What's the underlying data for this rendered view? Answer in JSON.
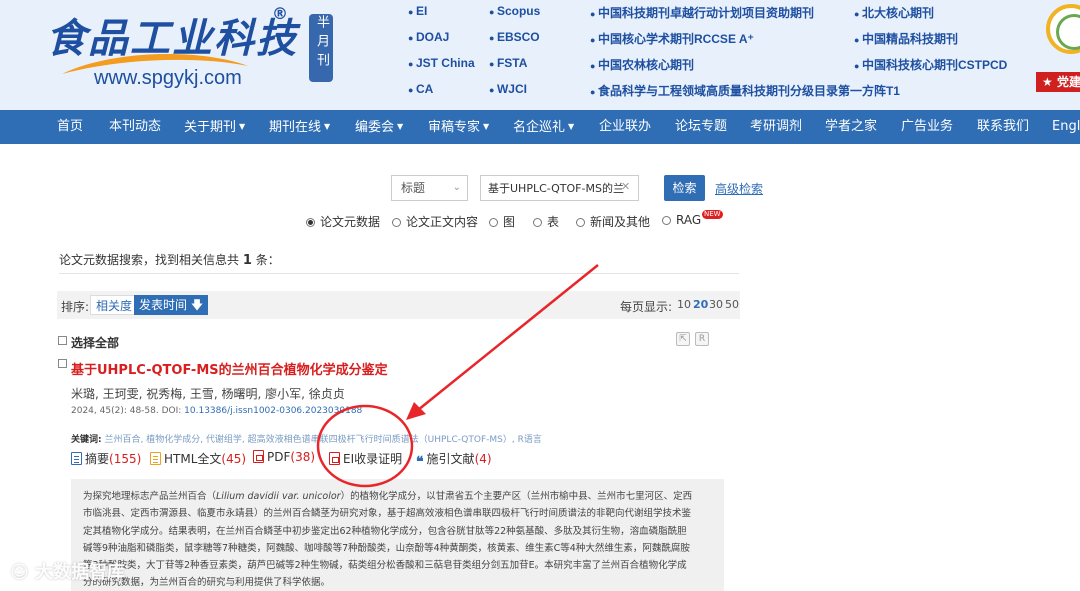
{
  "header": {
    "logo_title": "食品工业科技",
    "logo_reg": "®",
    "logo_url": "www.spgykj.com",
    "frequency": "半月刊",
    "indexes_col1": [
      "EI",
      "DOAJ",
      "JST China",
      "CA"
    ],
    "indexes_col2": [
      "Scopus",
      "EBSCO",
      "FSTA",
      "WJCI"
    ],
    "indexes_col3": [
      "中国科技期刊卓越行动计划项目资助期刊",
      "中国核心学术期刊RCCSE A⁺",
      "中国农林核心期刊",
      "食品科学与工程领域高质量科技期刊分级目录第一方阵T1"
    ],
    "indexes_col4": [
      "北大核心期刊",
      "中国精品科技期刊",
      "中国科技核心期刊CSTPCD"
    ],
    "party_tag": "党建"
  },
  "nav": {
    "items": [
      {
        "label": "首页",
        "dropdown": false
      },
      {
        "label": "本刊动态",
        "dropdown": false
      },
      {
        "label": "关于期刊",
        "dropdown": true
      },
      {
        "label": "期刊在线",
        "dropdown": true
      },
      {
        "label": "编委会",
        "dropdown": true
      },
      {
        "label": "审稿专家",
        "dropdown": true
      },
      {
        "label": "名企巡礼",
        "dropdown": true
      },
      {
        "label": "企业联办",
        "dropdown": false
      },
      {
        "label": "论坛专题",
        "dropdown": false
      },
      {
        "label": "考研调剂",
        "dropdown": false
      },
      {
        "label": "学者之家",
        "dropdown": false
      },
      {
        "label": "广告业务",
        "dropdown": false
      },
      {
        "label": "联系我们",
        "dropdown": false
      },
      {
        "label": "English",
        "dropdown": false
      }
    ]
  },
  "search": {
    "field_select": "标题",
    "query": "基于UHPLC-QTOF-MS的兰",
    "button": "检索",
    "advanced": "高级检索",
    "scopes": [
      {
        "label": "论文元数据",
        "checked": true
      },
      {
        "label": "论文正文内容",
        "checked": false
      },
      {
        "label": "图",
        "checked": false
      },
      {
        "label": "表",
        "checked": false
      },
      {
        "label": "新闻及其他",
        "checked": false
      },
      {
        "label": "RAG",
        "checked": false
      }
    ],
    "new_badge": "NEW"
  },
  "results": {
    "summary_prefix": "论文元数据搜索，找到相关信息共",
    "count": "1",
    "summary_suffix": "条：",
    "sort_label": "排序:",
    "sort_relevance": "相关度",
    "sort_time": "发表时间",
    "per_page_label": "每页显示:",
    "per_page_options": [
      "10",
      "20",
      "30",
      "50"
    ],
    "per_page_selected": "20",
    "select_all": "选择全部"
  },
  "paper": {
    "title": "基于UHPLC-QTOF-MS的兰州百合植物化学成分鉴定",
    "authors": "米璐, 王珂雯, 祝秀梅, 王雪, 杨曙明, 廖小军, 徐贞贞",
    "citation": "2024, 45(2): 48-58. DOI:",
    "doi": "10.13386/j.issn1002-0306.2023030188",
    "keywords_label": "关键词:",
    "keywords": "兰州百合, 植物化学成分, 代谢组学, 超高效液相色谱串联四极杆飞行时间质谱法（UHPLC-QTOF-MS）, R语言",
    "links": {
      "abstract": "摘要",
      "abstract_count": "(155)",
      "html": "HTML全文",
      "html_count": "(45)",
      "pdf": "PDF",
      "pdf_count": "(38)",
      "ei_cert": "EI收录证明",
      "cited": "施引文献",
      "cited_count": "(4)"
    },
    "abstract_lines": [
      "为探究地理标志产品兰州百合（",
      "Lilium davidii var. unicolor",
      "）的植物化学成分，以甘肃省五个主要产区（兰州市榆中县、兰州市七里河区、定西",
      "市临洮县、定西市渭源县、临夏市永靖县）的兰州百合鳞茎为研究对象，基于超高效液相色谱串联四极杆飞行时间质谱法的非靶向代谢组学技术鉴",
      "定其植物化学成分。结果表明，在兰州百合鳞茎中初步鉴定出62种植物化学成分，包含谷胱甘肽等22种氨基酸、多肽及其衍生物，溶血磷脂酰胆",
      "碱等9种油脂和磷脂类，鼠李糖等7种糖类，阿魏酸、咖啡酸等7种酚酸类，山奈酚等4种黄酮类，核黄素、维生素C等4种大然维生素，阿魏酰腐胺",
      "等3种酚胺类，大丁苷等2种香豆素类，葫芦巴碱等2种生物碱，萜类组分松香酸和三萜皂苷类组分剑五加苷E。本研究丰富了兰州百合植物化学成",
      "分的研究数据，为兰州百合的研究与利用提供了科学依据。"
    ]
  },
  "watermark": "大数据智库",
  "annotation_color": "#e8262a"
}
